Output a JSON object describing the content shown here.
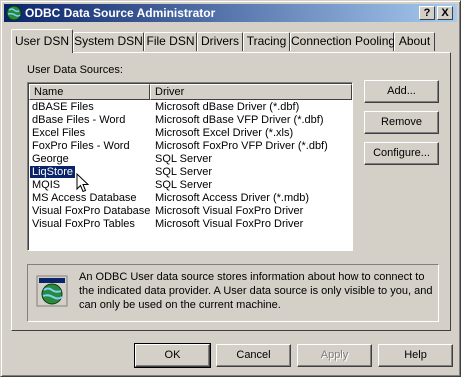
{
  "window": {
    "title": "ODBC Data Source Administrator",
    "help_button": "?",
    "close_button": "X",
    "icon": "odbc-globe-icon"
  },
  "tabs": [
    {
      "label": "User DSN",
      "active": true
    },
    {
      "label": "System DSN",
      "active": false
    },
    {
      "label": "File DSN",
      "active": false
    },
    {
      "label": "Drivers",
      "active": false
    },
    {
      "label": "Tracing",
      "active": false
    },
    {
      "label": "Connection Pooling",
      "active": false
    },
    {
      "label": "About",
      "active": false
    }
  ],
  "user_dsn": {
    "section_label": "User Data Sources:",
    "columns": [
      "Name",
      "Driver"
    ],
    "rows": [
      {
        "name": "dBASE Files",
        "driver": "Microsoft dBase Driver (*.dbf)"
      },
      {
        "name": "dBase Files - Word",
        "driver": "Microsoft dBase VFP Driver (*.dbf)"
      },
      {
        "name": "Excel Files",
        "driver": "Microsoft Excel Driver (*.xls)"
      },
      {
        "name": "FoxPro Files - Word",
        "driver": "Microsoft FoxPro VFP Driver (*.dbf)"
      },
      {
        "name": "George",
        "driver": "SQL Server"
      },
      {
        "name": "LiqStore",
        "driver": "SQL Server",
        "selected": true
      },
      {
        "name": "MQIS",
        "driver": "SQL Server"
      },
      {
        "name": "MS Access Database",
        "driver": "Microsoft Access Driver (*.mdb)"
      },
      {
        "name": "Visual FoxPro Database",
        "driver": "Microsoft Visual FoxPro Driver"
      },
      {
        "name": "Visual FoxPro Tables",
        "driver": "Microsoft Visual FoxPro Driver"
      }
    ],
    "add_label": "Add...",
    "remove_label": "Remove",
    "configure_label": "Configure...",
    "info_text": "An ODBC User data source stores information about how to connect to the indicated data provider.  A User data source is only visible to you, and can only be used on the current machine."
  },
  "footer": {
    "ok_label": "OK",
    "cancel_label": "Cancel",
    "apply_label": "Apply",
    "apply_enabled": false,
    "help_label": "Help"
  },
  "colors": {
    "titlebar_start": "#0a246a",
    "titlebar_end": "#a6caf0",
    "selection": "#0a246a",
    "face": "#d4d0c8"
  }
}
